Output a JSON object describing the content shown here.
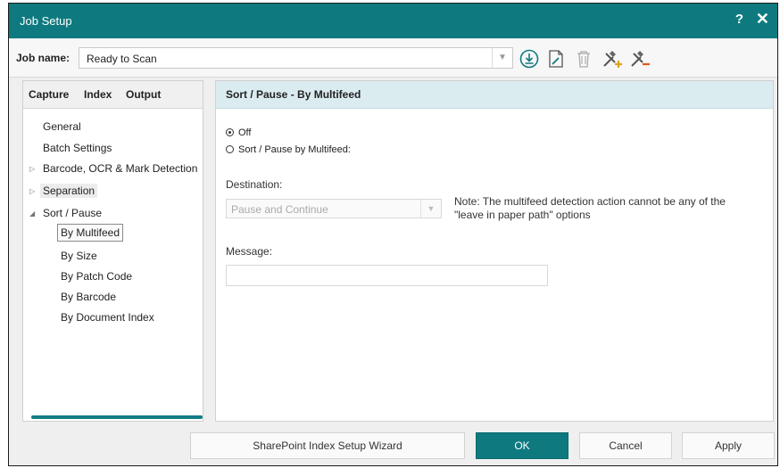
{
  "window": {
    "title": "Job Setup",
    "help_label": "?",
    "close_label": "✕"
  },
  "job": {
    "label": "Job name:",
    "value": "Ready to Scan"
  },
  "toolbar": {
    "icons": [
      "download-icon",
      "edit-document-icon",
      "delete-icon",
      "tools-add-icon",
      "tools-remove-icon"
    ]
  },
  "tabs": [
    {
      "label": "Capture"
    },
    {
      "label": "Index"
    },
    {
      "label": "Output"
    }
  ],
  "tree": {
    "general": "General",
    "batch_settings": "Batch Settings",
    "barcode": "Barcode, OCR & Mark Detection",
    "separation": "Separation",
    "sort_pause": "Sort / Pause",
    "by_multifeed": "By Multifeed",
    "by_size": "By Size",
    "by_patch_code": "By Patch Code",
    "by_barcode": "By Barcode",
    "by_document_index": "By Document Index"
  },
  "panel": {
    "title": "Sort / Pause - By Multifeed",
    "radio_off": "Off",
    "radio_by_multifeed": "Sort / Pause by Multifeed:",
    "selected_option": "Off",
    "destination_label": "Destination:",
    "destination_value": "Pause and Continue",
    "note": "Note: The multifeed detection action cannot be any of the \"leave in paper path\" options",
    "message_label": "Message:",
    "message_value": ""
  },
  "buttons": {
    "sharepoint": "SharePoint Index Setup Wizard",
    "ok": "OK",
    "cancel": "Cancel",
    "apply": "Apply"
  },
  "colors": {
    "accent": "#0e7a7f",
    "panel_header": "#dbecf0"
  }
}
